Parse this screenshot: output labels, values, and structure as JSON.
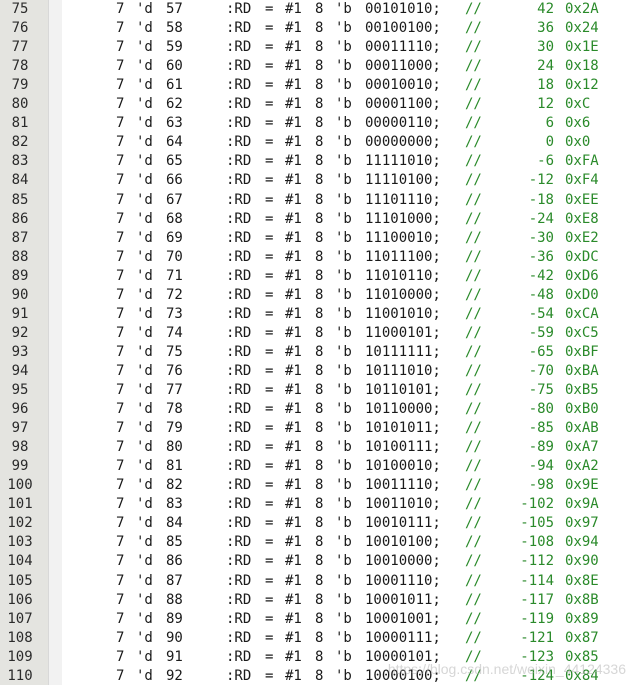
{
  "editor": {
    "lines": [
      {
        "ln": "75",
        "w": "7",
        "d": "'d",
        "addr": "57",
        "lbl": ":RD",
        "eq": "=",
        "cyc": "#1",
        "n": "8",
        "b": "'b",
        "bits": "00101010;",
        "cm": "//",
        "dec": "42",
        "hex": "0x2A"
      },
      {
        "ln": "76",
        "w": "7",
        "d": "'d",
        "addr": "58",
        "lbl": ":RD",
        "eq": "=",
        "cyc": "#1",
        "n": "8",
        "b": "'b",
        "bits": "00100100;",
        "cm": "//",
        "dec": "36",
        "hex": "0x24"
      },
      {
        "ln": "77",
        "w": "7",
        "d": "'d",
        "addr": "59",
        "lbl": ":RD",
        "eq": "=",
        "cyc": "#1",
        "n": "8",
        "b": "'b",
        "bits": "00011110;",
        "cm": "//",
        "dec": "30",
        "hex": "0x1E"
      },
      {
        "ln": "78",
        "w": "7",
        "d": "'d",
        "addr": "60",
        "lbl": ":RD",
        "eq": "=",
        "cyc": "#1",
        "n": "8",
        "b": "'b",
        "bits": "00011000;",
        "cm": "//",
        "dec": "24",
        "hex": "0x18"
      },
      {
        "ln": "79",
        "w": "7",
        "d": "'d",
        "addr": "61",
        "lbl": ":RD",
        "eq": "=",
        "cyc": "#1",
        "n": "8",
        "b": "'b",
        "bits": "00010010;",
        "cm": "//",
        "dec": "18",
        "hex": "0x12"
      },
      {
        "ln": "80",
        "w": "7",
        "d": "'d",
        "addr": "62",
        "lbl": ":RD",
        "eq": "=",
        "cyc": "#1",
        "n": "8",
        "b": "'b",
        "bits": "00001100;",
        "cm": "//",
        "dec": "12",
        "hex": "0xC"
      },
      {
        "ln": "81",
        "w": "7",
        "d": "'d",
        "addr": "63",
        "lbl": ":RD",
        "eq": "=",
        "cyc": "#1",
        "n": "8",
        "b": "'b",
        "bits": "00000110;",
        "cm": "//",
        "dec": "6",
        "hex": "0x6"
      },
      {
        "ln": "82",
        "w": "7",
        "d": "'d",
        "addr": "64",
        "lbl": ":RD",
        "eq": "=",
        "cyc": "#1",
        "n": "8",
        "b": "'b",
        "bits": "00000000;",
        "cm": "//",
        "dec": "0",
        "hex": "0x0"
      },
      {
        "ln": "83",
        "w": "7",
        "d": "'d",
        "addr": "65",
        "lbl": ":RD",
        "eq": "=",
        "cyc": "#1",
        "n": "8",
        "b": "'b",
        "bits": "11111010;",
        "cm": "//",
        "dec": "-6",
        "hex": "0xFA"
      },
      {
        "ln": "84",
        "w": "7",
        "d": "'d",
        "addr": "66",
        "lbl": ":RD",
        "eq": "=",
        "cyc": "#1",
        "n": "8",
        "b": "'b",
        "bits": "11110100;",
        "cm": "//",
        "dec": "-12",
        "hex": "0xF4"
      },
      {
        "ln": "85",
        "w": "7",
        "d": "'d",
        "addr": "67",
        "lbl": ":RD",
        "eq": "=",
        "cyc": "#1",
        "n": "8",
        "b": "'b",
        "bits": "11101110;",
        "cm": "//",
        "dec": "-18",
        "hex": "0xEE"
      },
      {
        "ln": "86",
        "w": "7",
        "d": "'d",
        "addr": "68",
        "lbl": ":RD",
        "eq": "=",
        "cyc": "#1",
        "n": "8",
        "b": "'b",
        "bits": "11101000;",
        "cm": "//",
        "dec": "-24",
        "hex": "0xE8"
      },
      {
        "ln": "87",
        "w": "7",
        "d": "'d",
        "addr": "69",
        "lbl": ":RD",
        "eq": "=",
        "cyc": "#1",
        "n": "8",
        "b": "'b",
        "bits": "11100010;",
        "cm": "//",
        "dec": "-30",
        "hex": "0xE2"
      },
      {
        "ln": "88",
        "w": "7",
        "d": "'d",
        "addr": "70",
        "lbl": ":RD",
        "eq": "=",
        "cyc": "#1",
        "n": "8",
        "b": "'b",
        "bits": "11011100;",
        "cm": "//",
        "dec": "-36",
        "hex": "0xDC"
      },
      {
        "ln": "89",
        "w": "7",
        "d": "'d",
        "addr": "71",
        "lbl": ":RD",
        "eq": "=",
        "cyc": "#1",
        "n": "8",
        "b": "'b",
        "bits": "11010110;",
        "cm": "//",
        "dec": "-42",
        "hex": "0xD6"
      },
      {
        "ln": "90",
        "w": "7",
        "d": "'d",
        "addr": "72",
        "lbl": ":RD",
        "eq": "=",
        "cyc": "#1",
        "n": "8",
        "b": "'b",
        "bits": "11010000;",
        "cm": "//",
        "dec": "-48",
        "hex": "0xD0"
      },
      {
        "ln": "91",
        "w": "7",
        "d": "'d",
        "addr": "73",
        "lbl": ":RD",
        "eq": "=",
        "cyc": "#1",
        "n": "8",
        "b": "'b",
        "bits": "11001010;",
        "cm": "//",
        "dec": "-54",
        "hex": "0xCA"
      },
      {
        "ln": "92",
        "w": "7",
        "d": "'d",
        "addr": "74",
        "lbl": ":RD",
        "eq": "=",
        "cyc": "#1",
        "n": "8",
        "b": "'b",
        "bits": "11000101;",
        "cm": "//",
        "dec": "-59",
        "hex": "0xC5"
      },
      {
        "ln": "93",
        "w": "7",
        "d": "'d",
        "addr": "75",
        "lbl": ":RD",
        "eq": "=",
        "cyc": "#1",
        "n": "8",
        "b": "'b",
        "bits": "10111111;",
        "cm": "//",
        "dec": "-65",
        "hex": "0xBF"
      },
      {
        "ln": "94",
        "w": "7",
        "d": "'d",
        "addr": "76",
        "lbl": ":RD",
        "eq": "=",
        "cyc": "#1",
        "n": "8",
        "b": "'b",
        "bits": "10111010;",
        "cm": "//",
        "dec": "-70",
        "hex": "0xBA"
      },
      {
        "ln": "95",
        "w": "7",
        "d": "'d",
        "addr": "77",
        "lbl": ":RD",
        "eq": "=",
        "cyc": "#1",
        "n": "8",
        "b": "'b",
        "bits": "10110101;",
        "cm": "//",
        "dec": "-75",
        "hex": "0xB5"
      },
      {
        "ln": "96",
        "w": "7",
        "d": "'d",
        "addr": "78",
        "lbl": ":RD",
        "eq": "=",
        "cyc": "#1",
        "n": "8",
        "b": "'b",
        "bits": "10110000;",
        "cm": "//",
        "dec": "-80",
        "hex": "0xB0"
      },
      {
        "ln": "97",
        "w": "7",
        "d": "'d",
        "addr": "79",
        "lbl": ":RD",
        "eq": "=",
        "cyc": "#1",
        "n": "8",
        "b": "'b",
        "bits": "10101011;",
        "cm": "//",
        "dec": "-85",
        "hex": "0xAB"
      },
      {
        "ln": "98",
        "w": "7",
        "d": "'d",
        "addr": "80",
        "lbl": ":RD",
        "eq": "=",
        "cyc": "#1",
        "n": "8",
        "b": "'b",
        "bits": "10100111;",
        "cm": "//",
        "dec": "-89",
        "hex": "0xA7"
      },
      {
        "ln": "99",
        "w": "7",
        "d": "'d",
        "addr": "81",
        "lbl": ":RD",
        "eq": "=",
        "cyc": "#1",
        "n": "8",
        "b": "'b",
        "bits": "10100010;",
        "cm": "//",
        "dec": "-94",
        "hex": "0xA2"
      },
      {
        "ln": "100",
        "w": "7",
        "d": "'d",
        "addr": "82",
        "lbl": ":RD",
        "eq": "=",
        "cyc": "#1",
        "n": "8",
        "b": "'b",
        "bits": "10011110;",
        "cm": "//",
        "dec": "-98",
        "hex": "0x9E"
      },
      {
        "ln": "101",
        "w": "7",
        "d": "'d",
        "addr": "83",
        "lbl": ":RD",
        "eq": "=",
        "cyc": "#1",
        "n": "8",
        "b": "'b",
        "bits": "10011010;",
        "cm": "//",
        "dec": "-102",
        "hex": "0x9A"
      },
      {
        "ln": "102",
        "w": "7",
        "d": "'d",
        "addr": "84",
        "lbl": ":RD",
        "eq": "=",
        "cyc": "#1",
        "n": "8",
        "b": "'b",
        "bits": "10010111;",
        "cm": "//",
        "dec": "-105",
        "hex": "0x97"
      },
      {
        "ln": "103",
        "w": "7",
        "d": "'d",
        "addr": "85",
        "lbl": ":RD",
        "eq": "=",
        "cyc": "#1",
        "n": "8",
        "b": "'b",
        "bits": "10010100;",
        "cm": "//",
        "dec": "-108",
        "hex": "0x94"
      },
      {
        "ln": "104",
        "w": "7",
        "d": "'d",
        "addr": "86",
        "lbl": ":RD",
        "eq": "=",
        "cyc": "#1",
        "n": "8",
        "b": "'b",
        "bits": "10010000;",
        "cm": "//",
        "dec": "-112",
        "hex": "0x90"
      },
      {
        "ln": "105",
        "w": "7",
        "d": "'d",
        "addr": "87",
        "lbl": ":RD",
        "eq": "=",
        "cyc": "#1",
        "n": "8",
        "b": "'b",
        "bits": "10001110;",
        "cm": "//",
        "dec": "-114",
        "hex": "0x8E"
      },
      {
        "ln": "106",
        "w": "7",
        "d": "'d",
        "addr": "88",
        "lbl": ":RD",
        "eq": "=",
        "cyc": "#1",
        "n": "8",
        "b": "'b",
        "bits": "10001011;",
        "cm": "//",
        "dec": "-117",
        "hex": "0x8B"
      },
      {
        "ln": "107",
        "w": "7",
        "d": "'d",
        "addr": "89",
        "lbl": ":RD",
        "eq": "=",
        "cyc": "#1",
        "n": "8",
        "b": "'b",
        "bits": "10001001;",
        "cm": "//",
        "dec": "-119",
        "hex": "0x89"
      },
      {
        "ln": "108",
        "w": "7",
        "d": "'d",
        "addr": "90",
        "lbl": ":RD",
        "eq": "=",
        "cyc": "#1",
        "n": "8",
        "b": "'b",
        "bits": "10000111;",
        "cm": "//",
        "dec": "-121",
        "hex": "0x87"
      },
      {
        "ln": "109",
        "w": "7",
        "d": "'d",
        "addr": "91",
        "lbl": ":RD",
        "eq": "=",
        "cyc": "#1",
        "n": "8",
        "b": "'b",
        "bits": "10000101;",
        "cm": "//",
        "dec": "-123",
        "hex": "0x85"
      },
      {
        "ln": "110",
        "w": "7",
        "d": "'d",
        "addr": "92",
        "lbl": ":RD",
        "eq": "=",
        "cyc": "#1",
        "n": "8",
        "b": "'b",
        "bits": "10000100;",
        "cm": "//",
        "dec": "-124",
        "hex": "0x84"
      }
    ]
  },
  "watermark": "https://blog.csdn.net/weixin_44124336",
  "colors": {
    "gutter": "#e4e4e0",
    "text": "#1a1a1a",
    "comment": "#2a8a2a"
  }
}
